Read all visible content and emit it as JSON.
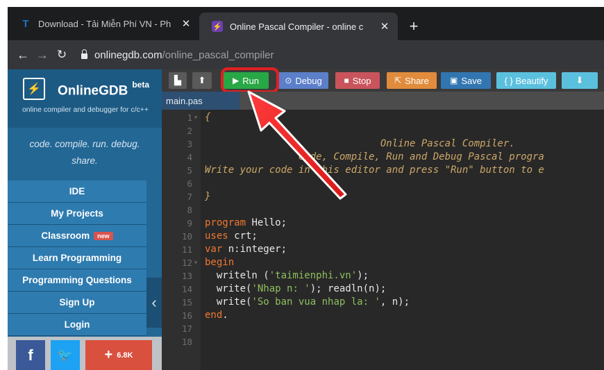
{
  "browser": {
    "tabs": [
      {
        "title": "Download - Tải Miễn Phí VN - Ph",
        "close": "✕"
      },
      {
        "title": "Online Pascal Compiler - online c",
        "close": "✕"
      }
    ],
    "new_tab": "+",
    "url_host": "onlinegdb.com",
    "url_path": "/online_pascal_compiler"
  },
  "sidebar": {
    "brand": "OnlineGDB",
    "brand_beta": "beta",
    "brand_sub": "online compiler and debugger for c/c++",
    "slogan_line1": "code. compile. run. debug.",
    "slogan_line2": "share.",
    "menu": [
      {
        "label": "IDE"
      },
      {
        "label": "My Projects"
      },
      {
        "label": "Classroom",
        "badge": "new"
      },
      {
        "label": "Learn Programming"
      },
      {
        "label": "Programming Questions"
      },
      {
        "label": "Sign Up"
      },
      {
        "label": "Login"
      }
    ],
    "collapse": "‹",
    "share_count": "6.8K"
  },
  "toolbar": {
    "run": "Run",
    "debug": "Debug",
    "stop": "Stop",
    "share": "Share",
    "save": "Save",
    "beautify": "{ } Beautify",
    "download": "⬇"
  },
  "file_tab": "main.pas",
  "code_lines": [
    {
      "n": "1",
      "fold": true
    },
    {
      "n": "2"
    },
    {
      "n": "3"
    },
    {
      "n": "4"
    },
    {
      "n": "5"
    },
    {
      "n": "6"
    },
    {
      "n": "7"
    },
    {
      "n": "8"
    },
    {
      "n": "9"
    },
    {
      "n": "10"
    },
    {
      "n": "11"
    },
    {
      "n": "12",
      "fold": true
    },
    {
      "n": "13"
    },
    {
      "n": "14"
    },
    {
      "n": "15"
    },
    {
      "n": "16"
    },
    {
      "n": "17"
    },
    {
      "n": "18"
    }
  ],
  "code": {
    "l1": "{",
    "l3": "                              Online Pascal Compiler.",
    "l4": "                Code, Compile, Run and Debug Pascal progra",
    "l5": "Write your code in this editor and press \"Run\" button to e",
    "l7": "}",
    "l9_kw": "program",
    "l9_rest": " Hello;",
    "l10_kw": "uses",
    "l10_rest": " crt;",
    "l11_kw": "var",
    "l11_rest": " n:integer;",
    "l12_kw": "begin",
    "l13_a": "  writeln (",
    "l13_s": "'taimienphi.vn'",
    "l13_b": ");",
    "l14_a": "  write(",
    "l14_s": "'Nhap n: '",
    "l14_b": "); readln(n);",
    "l15_a": "  write(",
    "l15_s": "'So ban vua nhap la: '",
    "l15_b": ", n);",
    "l16_kw": "end",
    "l16_rest": "."
  },
  "colors": {
    "run": "#28a745",
    "highlight": "#e02020",
    "sidebar": "#236795"
  }
}
